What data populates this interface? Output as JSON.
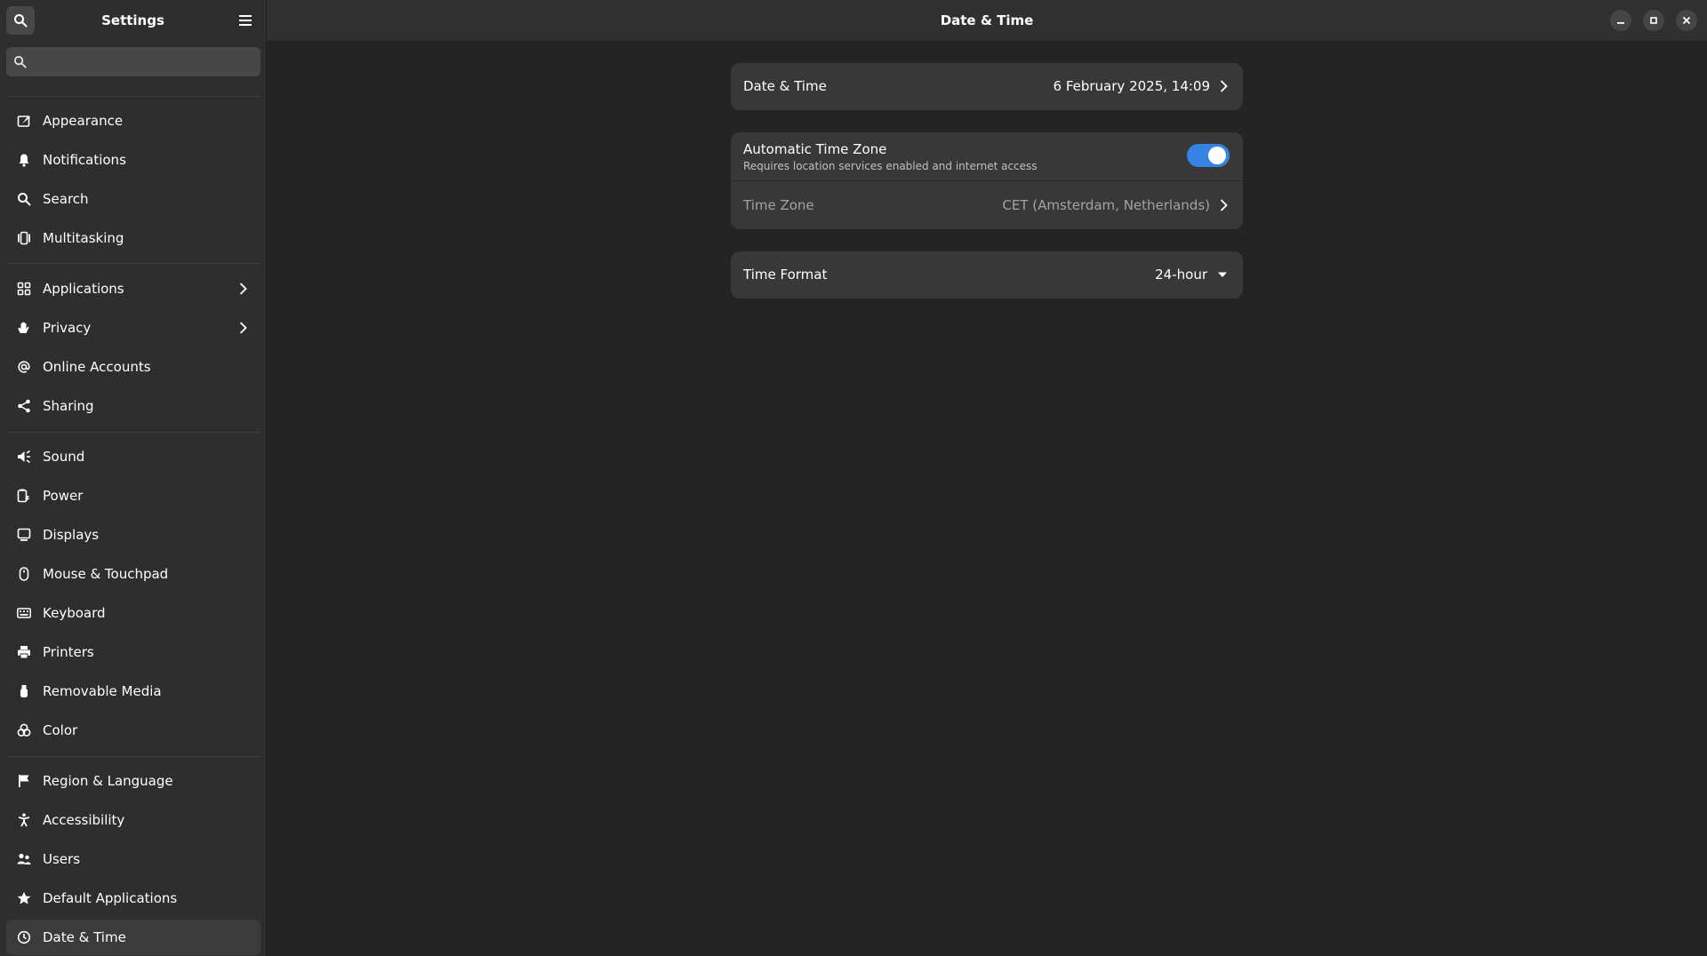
{
  "sidebar": {
    "title": "Settings",
    "search_placeholder": "",
    "items": [
      {
        "label": "Appearance",
        "icon": "appearance-icon"
      },
      {
        "label": "Notifications",
        "icon": "bell-icon"
      },
      {
        "label": "Search",
        "icon": "search-icon"
      },
      {
        "label": "Multitasking",
        "icon": "multitasking-icon"
      },
      {
        "label": "Applications",
        "icon": "grid-icon"
      },
      {
        "label": "Privacy",
        "icon": "hand-icon"
      },
      {
        "label": "Online Accounts",
        "icon": "at-icon"
      },
      {
        "label": "Sharing",
        "icon": "share-icon"
      },
      {
        "label": "Sound",
        "icon": "speaker-icon"
      },
      {
        "label": "Power",
        "icon": "power-icon"
      },
      {
        "label": "Displays",
        "icon": "display-icon"
      },
      {
        "label": "Mouse & Touchpad",
        "icon": "mouse-icon"
      },
      {
        "label": "Keyboard",
        "icon": "keyboard-icon"
      },
      {
        "label": "Printers",
        "icon": "printer-icon"
      },
      {
        "label": "Removable Media",
        "icon": "usb-icon"
      },
      {
        "label": "Color",
        "icon": "color-icon"
      },
      {
        "label": "Region & Language",
        "icon": "flag-icon"
      },
      {
        "label": "Accessibility",
        "icon": "accessibility-icon"
      },
      {
        "label": "Users",
        "icon": "users-icon"
      },
      {
        "label": "Default Applications",
        "icon": "star-icon"
      },
      {
        "label": "Date & Time",
        "icon": "clock-icon",
        "active": true
      }
    ]
  },
  "main": {
    "title": "Date & Time",
    "date_time": {
      "label": "Date & Time",
      "value": "6 February 2025, 14:09"
    },
    "auto_tz": {
      "label": "Automatic Time Zone",
      "subtitle": "Requires location services enabled and internet access",
      "enabled": true
    },
    "time_zone": {
      "label": "Time Zone",
      "value": "CET (Amsterdam, Netherlands)"
    },
    "time_format": {
      "label": "Time Format",
      "value": "24-hour"
    }
  },
  "colors": {
    "accent": "#3584e4",
    "sidebar_bg": "#2e2e2e",
    "main_bg": "#242424",
    "card_bg": "#383838"
  }
}
